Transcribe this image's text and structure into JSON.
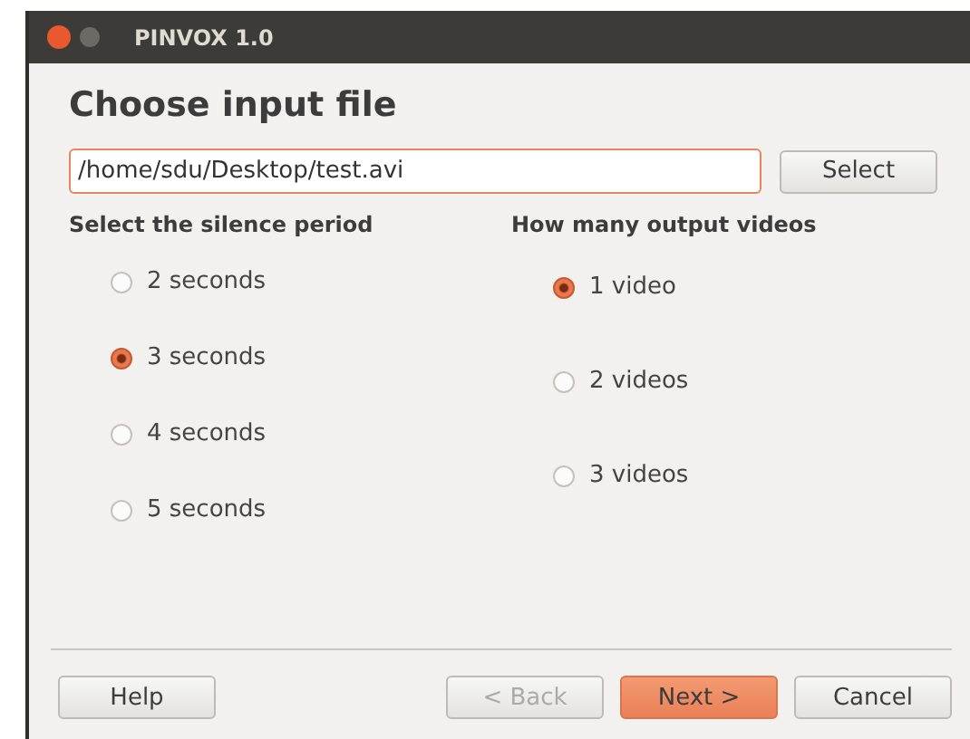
{
  "window": {
    "title": "PINVOX 1.0"
  },
  "heading": "Choose input file",
  "file_field": {
    "value": "/home/sdu/Desktop/test.avi",
    "focused": true
  },
  "select_button": "Select",
  "groups": [
    {
      "label": "Select the silence period",
      "options": [
        {
          "label": "2 seconds",
          "selected": false
        },
        {
          "label": "3 seconds",
          "selected": true
        },
        {
          "label": "4 seconds",
          "selected": false
        },
        {
          "label": "5 seconds",
          "selected": false
        }
      ]
    },
    {
      "label": "How many output videos",
      "options": [
        {
          "label": "1 video",
          "selected": true
        },
        {
          "label": "2 videos",
          "selected": false
        },
        {
          "label": "3 videos",
          "selected": false
        }
      ]
    }
  ],
  "buttons": [
    {
      "label": "Help",
      "disabled": false,
      "default": false
    },
    {
      "label": "< Back",
      "disabled": true,
      "default": false
    },
    {
      "label": "Next >",
      "disabled": false,
      "default": true
    },
    {
      "label": "Cancel",
      "disabled": false,
      "default": false
    }
  ]
}
